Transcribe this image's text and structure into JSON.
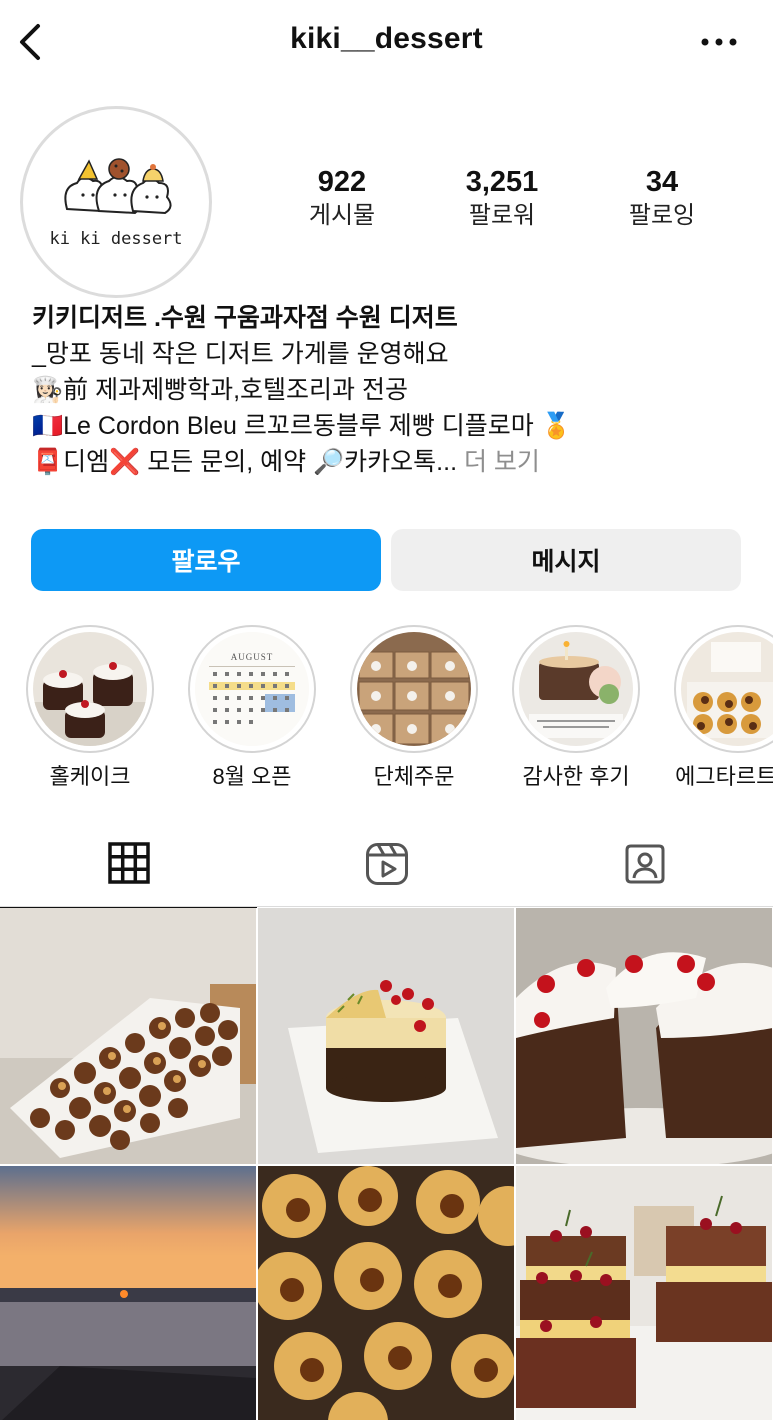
{
  "header": {
    "username": "kiki__dessert",
    "back_icon": "chevron-left-icon",
    "more_icon": "more-horizontal-icon"
  },
  "profile": {
    "avatar_text": "ki ki dessert",
    "stats": [
      {
        "value": "922",
        "label": "게시물"
      },
      {
        "value": "3,251",
        "label": "팔로워"
      },
      {
        "value": "34",
        "label": "팔로잉"
      }
    ],
    "bio": {
      "name": "키키디저트 .수원 구움과자점 수원 디저트",
      "line1": "_망포 동네 작은 디저트 가게를 운영해요",
      "line2_emoji": "👩🏻‍🍳",
      "line2": "前 제과제빵학과,호텔조리과 전공",
      "line3_emoji": "🇫🇷",
      "line3": "Le Cordon Bleu 르꼬르동블루 제빵 디플로마",
      "line3_suffix": "🏅",
      "line4_emoji": "📮",
      "line4_a": "디엠",
      "line4_x": "❌",
      "line4_b": " 모든 문의, 예약 ",
      "line4_search": "🔎",
      "line4_c": "카카오톡...",
      "more": " 더 보기"
    }
  },
  "actions": {
    "follow_label": "팔로우",
    "message_label": "메시지"
  },
  "highlights": [
    {
      "label": "홀케이크"
    },
    {
      "label": "8월 오픈",
      "calendar_month": "AUGUST"
    },
    {
      "label": "단체주문"
    },
    {
      "label": "감사한 후기"
    },
    {
      "label": "에그타르트 ..."
    }
  ],
  "tabs": [
    {
      "icon": "grid-icon",
      "active": true
    },
    {
      "icon": "reels-icon",
      "active": false
    },
    {
      "icon": "tagged-person-icon",
      "active": false
    }
  ],
  "colors": {
    "accent": "#0d99f5",
    "secondary_button": "#efefef",
    "muted_text": "#8e8e8e"
  }
}
